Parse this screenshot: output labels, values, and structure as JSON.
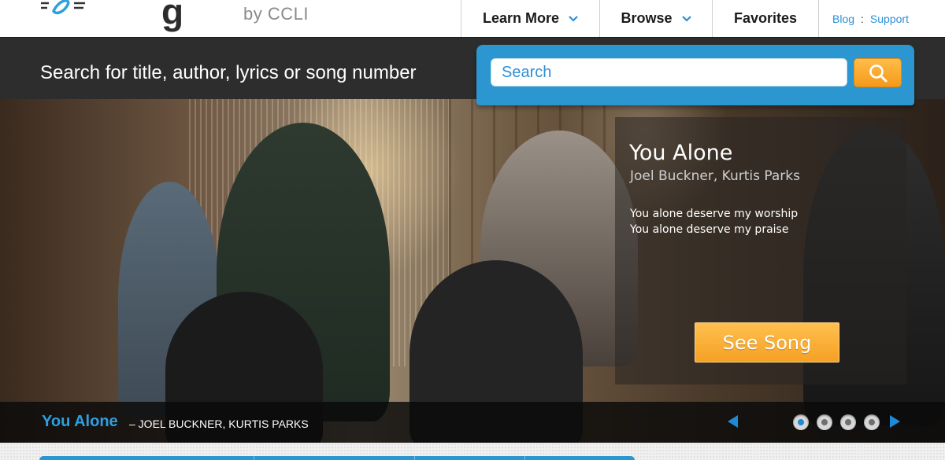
{
  "header": {
    "logo_tag": "by CCLI",
    "logo_word_fragment": "g",
    "nav": [
      {
        "label": "Learn More",
        "has_dropdown": true
      },
      {
        "label": "Browse",
        "has_dropdown": true
      },
      {
        "label": "Favorites",
        "has_dropdown": false
      }
    ],
    "utility": {
      "blog": "Blog",
      "separator": ":",
      "support": "Support"
    }
  },
  "search": {
    "prompt": "Search for title, author, lyrics or song number",
    "placeholder": "Search",
    "button_icon": "search-icon"
  },
  "hero": {
    "song_title": "You Alone",
    "song_authors": "Joel Buckner, Kurtis Parks",
    "lyrics": [
      "You alone deserve my worship",
      "You alone deserve my praise"
    ],
    "cta_label": "See Song"
  },
  "caption": {
    "title": "You Alone",
    "subtitle": "– JOEL BUCKNER, KURTIS PARKS",
    "slides": 4,
    "active_slide": 1
  },
  "colors": {
    "brand_blue": "#2b96cf",
    "accent_orange": "#f5a024",
    "dark_band": "#2d2d2d"
  }
}
